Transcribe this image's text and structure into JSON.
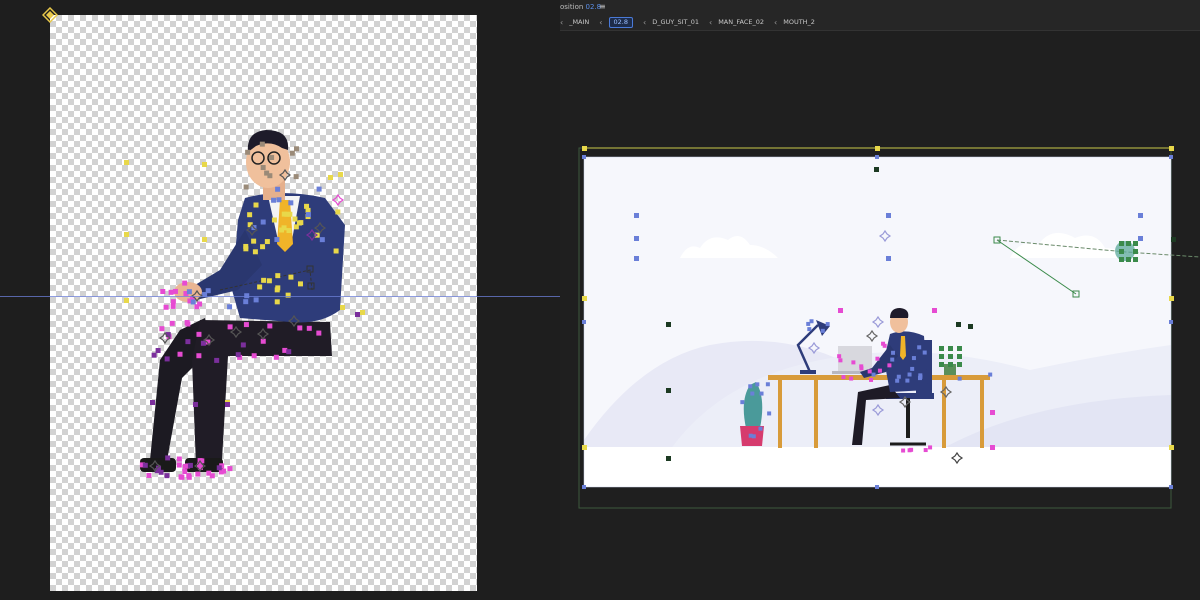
{
  "composition": {
    "title_prefix": "osition",
    "title_value": "02.8",
    "menu_icon": "hamburger-menu-icon",
    "breadcrumbs": [
      {
        "label": "_MAIN",
        "active": false
      },
      {
        "label": "02.8",
        "active": true
      },
      {
        "label": "D_GUY_SIT_01",
        "active": false
      },
      {
        "label": "MAN_FACE_02",
        "active": false
      },
      {
        "label": "MOUTH_2",
        "active": false
      }
    ]
  },
  "colors": {
    "workspace_bg": "#1e1e1e",
    "accent_blue": "#4a7ad8",
    "suit_navy": "#2e3c7a",
    "tie_yellow": "#f0b429",
    "desk_orange": "#d89b3a",
    "plant_teal": "#4a9a9a",
    "pot_pink": "#d63b6e",
    "handle_yellow": "#e8d84a",
    "handle_pink": "#e64bd2",
    "handle_purple": "#7b2f9c",
    "handle_blue": "#6a7fd8",
    "handle_green": "#3a8a4a"
  },
  "icons": [
    "anchor-point-icon",
    "chevron-left-icon",
    "hamburger-menu-icon",
    "puppet-pin-icon"
  ]
}
